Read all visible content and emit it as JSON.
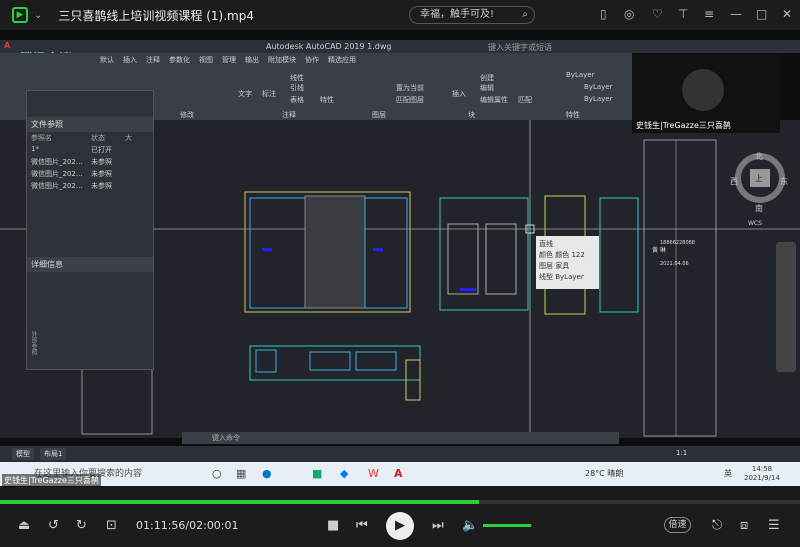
{
  "player": {
    "title": "三只喜鹊线上培训视频课程 (1).mp4",
    "search_text": "幸福，触手可及!",
    "current_time": "01:11:56",
    "duration": "02:00:01",
    "time_display": "01:11:56/02:00:01",
    "progress": 0.599,
    "speed_label": "倍速",
    "accent_color": "#2ecc40"
  },
  "autocad": {
    "window_title": "Autodesk AutoCAD 2019    1.dwg",
    "search_placeholder": "键入关键字或短语",
    "menu": [
      "默认",
      "插入",
      "注释",
      "参数化",
      "视图",
      "管理",
      "输出",
      "附加模块",
      "协作",
      "精选应用"
    ],
    "ribbon": {
      "text_label": "文字",
      "dim_label": "标注",
      "table_label": "表格",
      "insert_label": "插入",
      "props_label": "特性",
      "match_label": "匹配",
      "bylayer1": "ByLayer",
      "bylayer2": "ByLayer",
      "bylayer3": "ByLayer",
      "line_label": "线性",
      "lead_label": "引线",
      "create_label": "创建",
      "edit_label": "编辑",
      "edit_attr_label": "编辑属性",
      "layer_label": "图层",
      "modify_label": "修改",
      "annotate_label": "注释",
      "block_label": "块",
      "set_current": "置为当前",
      "match_layer": "匹配图层",
      "properties_label": "特性",
      "edit_group": "编组"
    },
    "doc_panel": {
      "header": "文件参照",
      "col_name": "参照名",
      "col_status": "状态",
      "col_size": "大",
      "rows": [
        {
          "name": "1*",
          "status": "已打开"
        },
        {
          "name": "微信图片_202...",
          "status": "未参照"
        },
        {
          "name": "微信图片_202...",
          "status": "未参照"
        },
        {
          "name": "微信图片_202...",
          "status": "未参照"
        }
      ],
      "details_label": "详细信息",
      "side_label": "外部参照"
    },
    "tooltip": {
      "title": "直线",
      "color_label": "颜色",
      "color_value": "颜色 122",
      "layer_label": "图层",
      "layer_value": "家具",
      "linetype_label": "线型",
      "linetype_value": "ByLayer"
    },
    "compass": {
      "north": "北",
      "south": "南",
      "west": "西",
      "east": "东",
      "top": "上",
      "wcs": "WCS"
    },
    "cmd_placeholder": "键入命令",
    "tabs": [
      "模型",
      "布局1"
    ],
    "scale": "1:1",
    "title_block_phone": "18866228088",
    "title_block_date": "2021.04.06",
    "title_block_name": "黄 琳"
  },
  "meeting": {
    "logo_text": "腾讯会议",
    "cam_name": "史钱生|TreGazze三只喜鹊"
  },
  "taskbar": {
    "search_text": "在这里输入你要搜索的内容",
    "temperature": "28°C  晴朗",
    "time": "14:58",
    "date": "2021/9/14",
    "tray_text": "英"
  },
  "overlay_name": "史钱生|TreGazze三只喜鹊"
}
